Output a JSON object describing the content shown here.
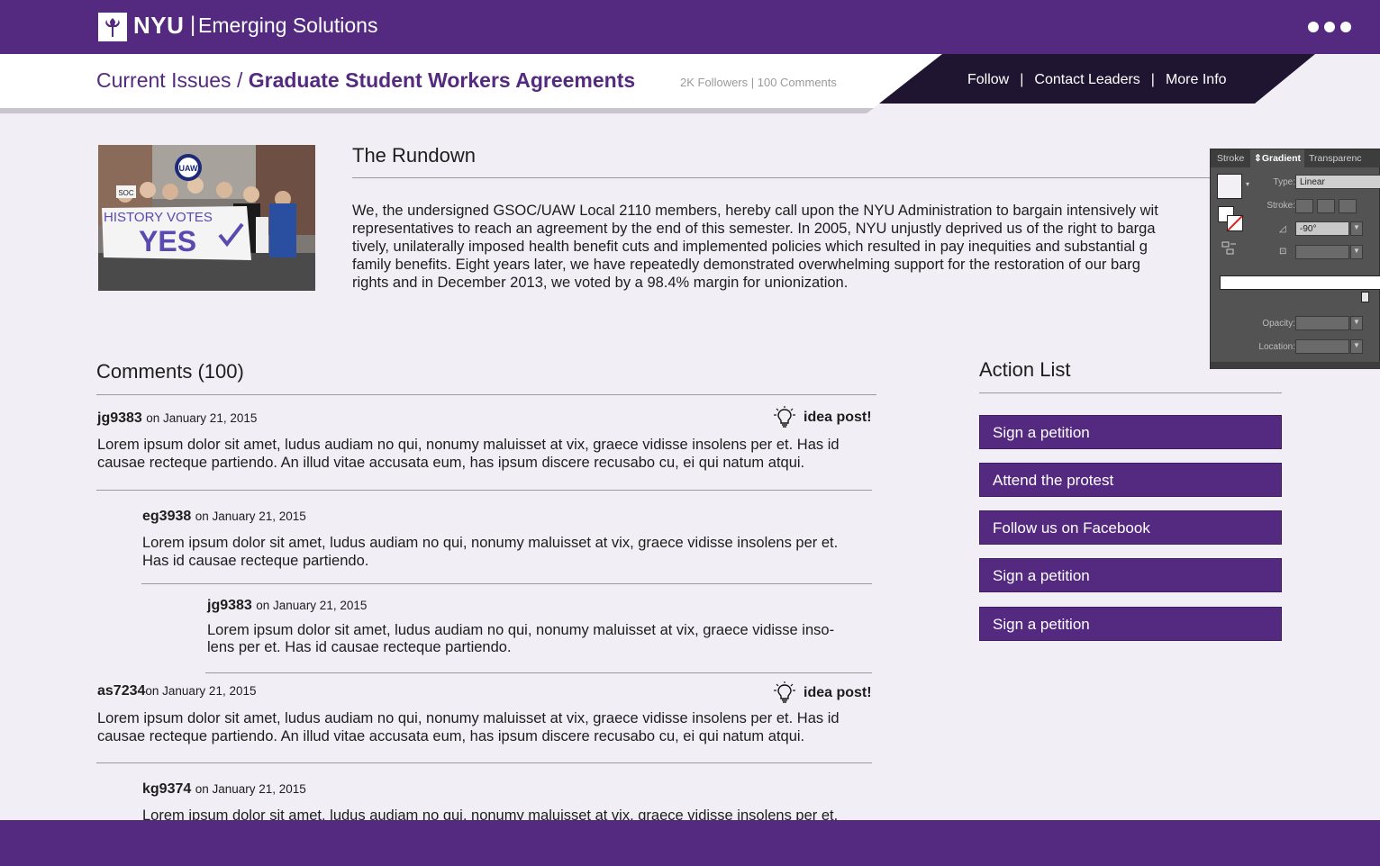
{
  "header": {
    "logo_text": "NYU",
    "separator": "|",
    "subtitle": "Emerging Solutions"
  },
  "subbar": {
    "breadcrumb_parent": "Current Issues",
    "breadcrumb_sep": " / ",
    "breadcrumb_current": "Graduate Student Workers Agreements",
    "stats": "2K Followers | 100 Comments",
    "nav": {
      "follow": "Follow",
      "contact": "Contact Leaders",
      "more": "More Info",
      "sep": "|"
    }
  },
  "hero": {
    "banner_line1": "HISTORY VOTES",
    "banner_line2": "YES",
    "sign_text": "UAW",
    "small_sign": "SOC"
  },
  "rundown": {
    "title": "The Rundown",
    "text": "We, the undersigned GSOC/UAW Local 2110 members, hereby call upon the NYU Administration to bargain intensively wit\nrepresentatives to reach an agreement by the end of this semester. In 2005, NYU unjustly deprived us of the right to barga\ntively, unilaterally imposed health benefit cuts and implemented policies which resulted in pay inequities and substantial g\nfamily benefits. Eight years later, we have repeatedly demonstrated overwhelming support for the restoration of our barg\nrights and in December 2013, we voted by a 98.4% margin for unionization."
  },
  "comments": {
    "title": "Comments (100)",
    "idea_label": "idea post!",
    "items": [
      {
        "user": "jg9383",
        "date": "on January 21, 2015",
        "body": "Lorem ipsum dolor sit amet, ludus audiam no qui, nonumy maluisset at vix, graece vidisse insolens per et. Has id\ncausae recteque partiendo. An illud vitae accusata eum, has ipsum discere recusabo cu, ei qui natum atqui."
      },
      {
        "user": "eg3938",
        "date": "on January 21, 2015",
        "body": "Lorem ipsum dolor sit amet, ludus audiam no qui, nonumy maluisset at vix, graece vidisse insolens per et.\nHas id causae recteque partiendo."
      },
      {
        "user": "jg9383",
        "date": "on January 21, 2015",
        "body": "Lorem ipsum dolor sit amet, ludus audiam no qui, nonumy maluisset at vix, graece vidisse inso-\nlens per et. Has id causae recteque partiendo."
      },
      {
        "user": "as7234",
        "date": "on January 21, 2015",
        "body": "Lorem ipsum dolor sit amet, ludus audiam no qui, nonumy maluisset at vix, graece vidisse insolens per et. Has id\ncausae recteque partiendo. An illud vitae accusata eum, has ipsum discere recusabo cu, ei qui natum atqui."
      },
      {
        "user": "kg9374",
        "date": "on January 21, 2015",
        "body": "Lorem ipsum dolor sit amet, ludus audiam no qui, nonumy maluisset at vix, graece vidisse insolens per et."
      }
    ]
  },
  "actions": {
    "title": "Action List",
    "items": [
      "Sign a petition",
      "Attend the protest",
      "Follow us on Facebook",
      "Sign a petition",
      "Sign a petition"
    ]
  },
  "gradient_panel": {
    "tabs": [
      "Stroke",
      "Gradient",
      "Transparenc"
    ],
    "type_label": "Type:",
    "type_value": "Linear",
    "stroke_label": "Stroke:",
    "angle_value": "-90°",
    "opacity_label": "Opacity:",
    "location_label": "Location:"
  },
  "colors": {
    "brand_purple": "#542a80",
    "dark_navy": "#1f1530",
    "page_bg": "#f1eef6"
  }
}
